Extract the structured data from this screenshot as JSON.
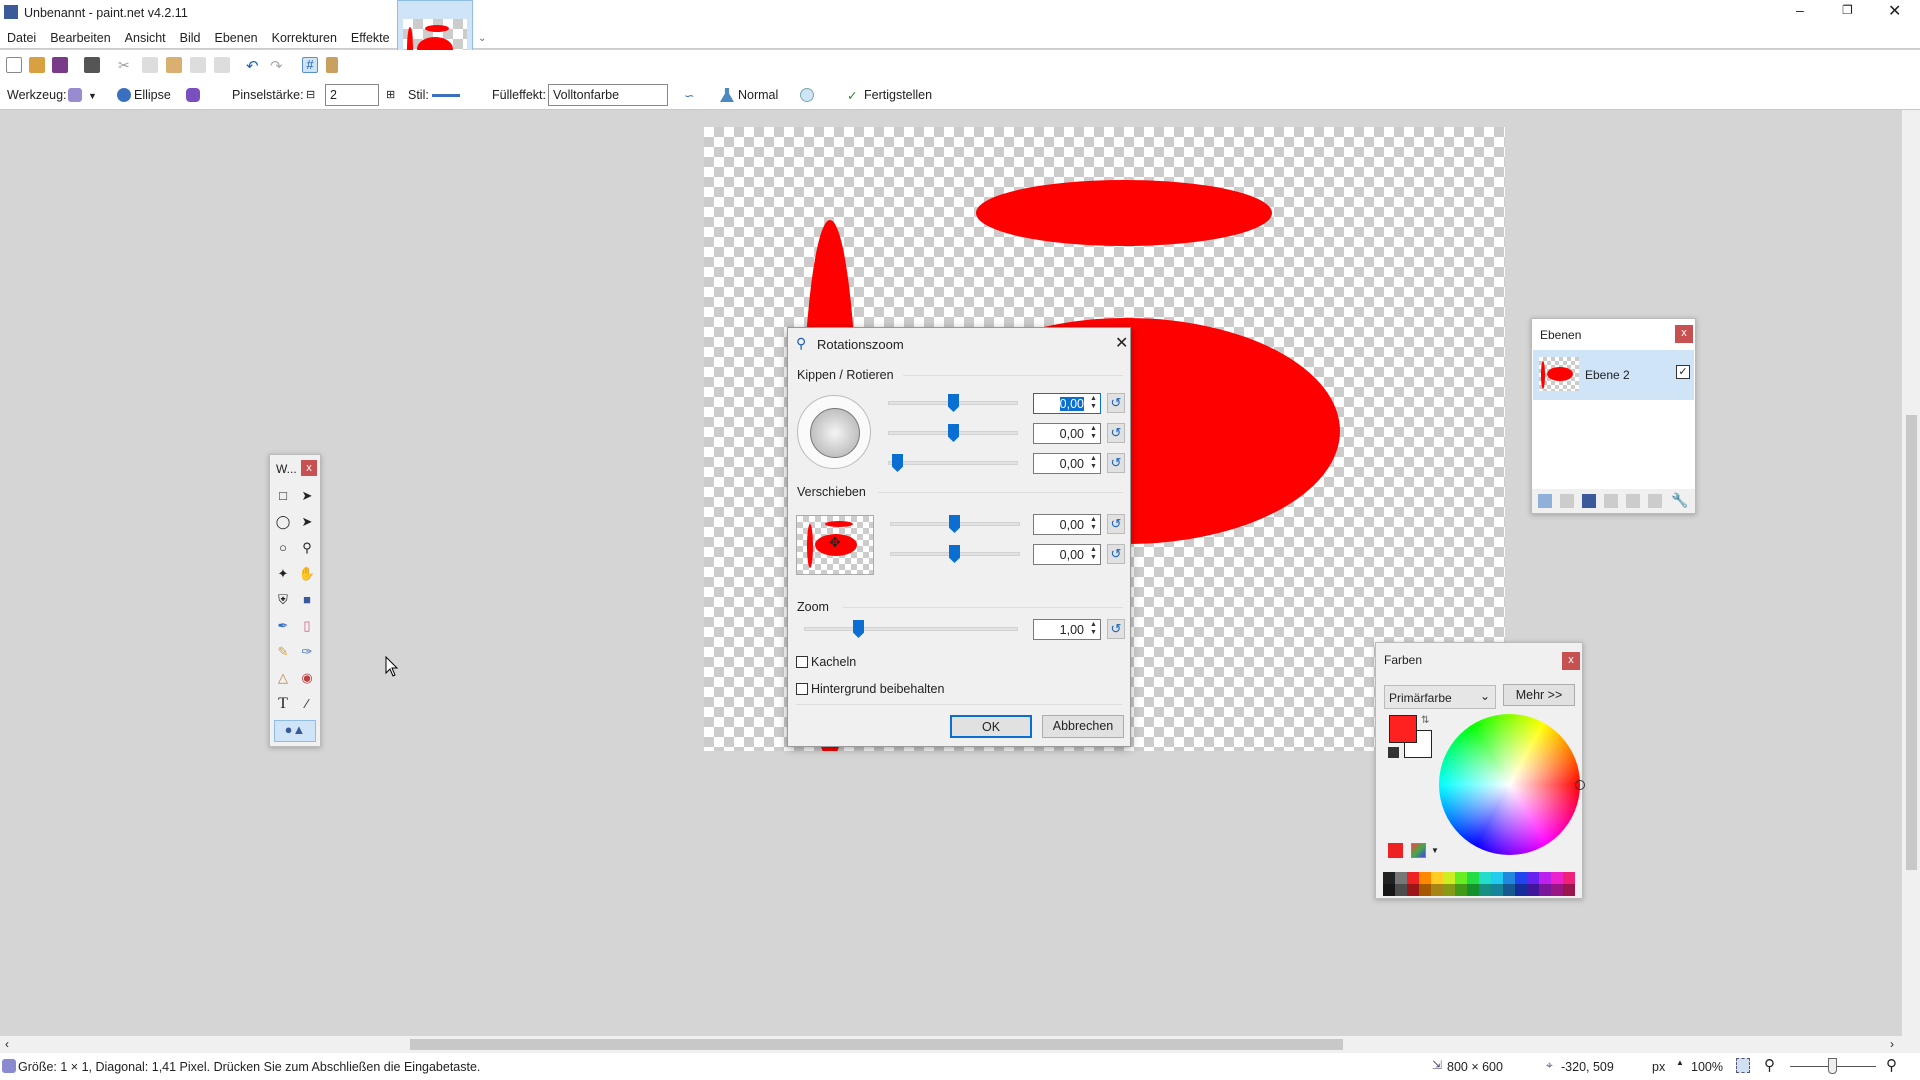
{
  "window": {
    "title": "Unbenannt - paint.net v4.2.11"
  },
  "menu": [
    "Datei",
    "Bearbeiten",
    "Ansicht",
    "Bild",
    "Ebenen",
    "Korrekturen",
    "Effekte"
  ],
  "tool_options": {
    "tool_label": "Werkzeug:",
    "shape": "Ellipse",
    "brush_width_label": "Pinselstärke:",
    "brush_width": "2",
    "style_label": "Stil:",
    "fill_label": "Fülleffekt:",
    "fill": "Volltonfarbe",
    "blend_mode": "Normal",
    "finish": "Fertigstellen"
  },
  "dialog": {
    "title": "Rotationszoom",
    "group_rotate": "Kippen / Rotieren",
    "group_pan": "Verschieben",
    "group_zoom": "Zoom",
    "rotate_values": [
      "0,00",
      "0,00",
      "0,00"
    ],
    "pan_values": [
      "0,00",
      "0,00"
    ],
    "zoom_value": "1,00",
    "tile_label": "Kacheln",
    "tile_checked": false,
    "keep_bg_label": "Hintergrund beibehalten",
    "keep_bg_checked": false,
    "ok": "OK",
    "cancel": "Abbrechen"
  },
  "tools_window": {
    "title": "W..."
  },
  "layers": {
    "title": "Ebenen",
    "items": [
      {
        "name": "Ebene 2",
        "visible": true
      }
    ]
  },
  "colors": {
    "title": "Farben",
    "mode": "Primärfarbe",
    "more": "Mehr >>",
    "primary": "#ff2020",
    "secondary": "#ffffff"
  },
  "status": {
    "message": "Größe: 1 × 1, Diagonal: 1,41 Pixel. Drücken Sie zum Abschließen die Eingabetaste.",
    "image_size": "800 × 600",
    "cursor_pos": "-320, 509",
    "unit": "px",
    "zoom": "100%"
  },
  "palette": [
    "#222",
    "#777",
    "#e22",
    "#f80",
    "#fc2",
    "#ce2",
    "#6e2",
    "#2d4",
    "#2dc",
    "#2ce",
    "#28d",
    "#24e",
    "#62e",
    "#b2e",
    "#e2c",
    "#e27"
  ]
}
